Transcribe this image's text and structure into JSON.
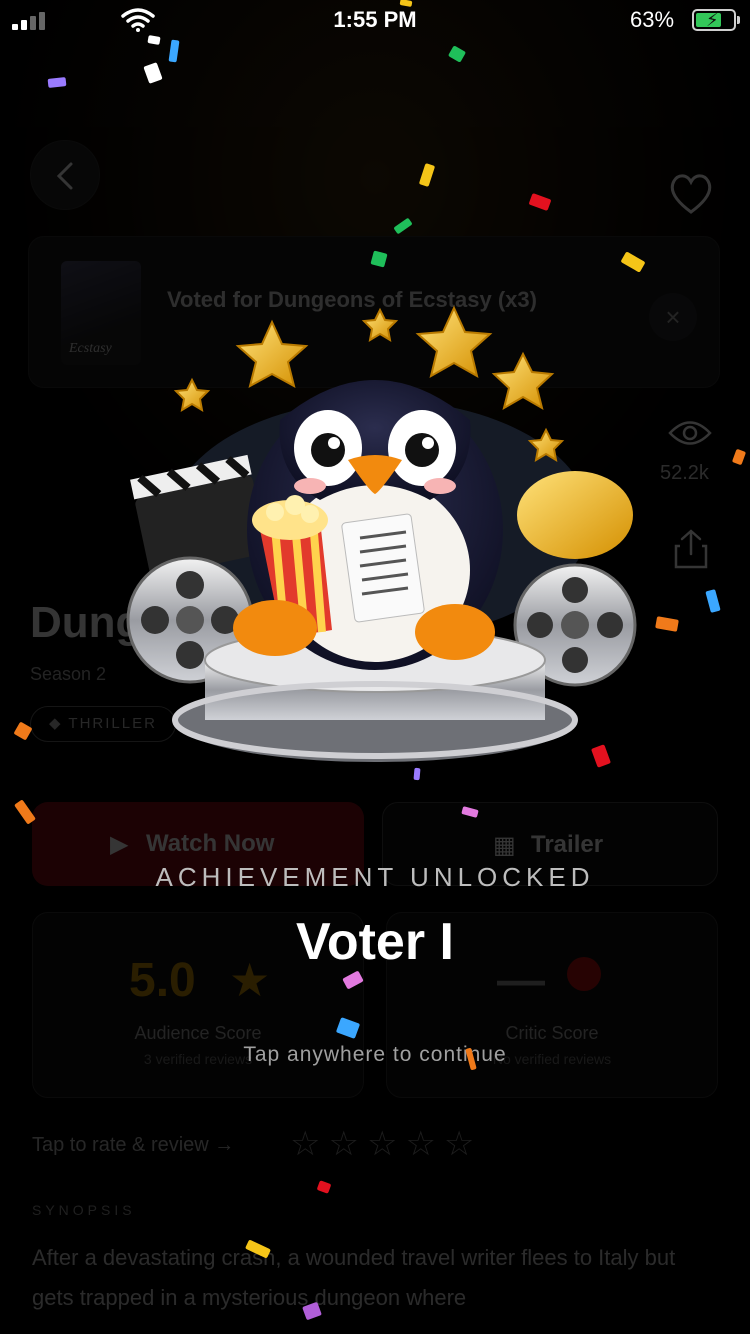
{
  "status_bar": {
    "time": "1:55 PM",
    "battery_percent": "63%",
    "battery_level": 0.63,
    "battery_color": "#33c759"
  },
  "toast": {
    "text": "Voted for Dungeons of Ecstasy (x3)",
    "close_icon": "close-icon"
  },
  "poster": {
    "thumb_text": "Ecstasy"
  },
  "stats": {
    "views": "52.2k"
  },
  "show": {
    "title": "Dungeons of Ecstasy",
    "season": "Season 2",
    "genre": "◆ THRILLER"
  },
  "actions": {
    "watch_label": "Watch Now",
    "trailer_label": "Trailer"
  },
  "scores": {
    "audience": {
      "value": "5.0",
      "label": "Audience Score",
      "sub": "3 verified reviews"
    },
    "critic": {
      "value": "—",
      "label": "Critic Score",
      "sub": "No verified reviews"
    }
  },
  "rating": {
    "prompt": "Tap to rate & review →",
    "stars": "☆☆☆☆☆"
  },
  "synopsis": {
    "heading": "SYNOPSIS",
    "text": "After a devastating crash, a wounded travel writer flees to Italy but gets trapped in a mysterious dungeon where"
  },
  "achievement": {
    "kicker": "ACHIEVEMENT UNLOCKED",
    "title": "Voter I",
    "hint": "Tap anywhere to continue",
    "badge_icon": "penguin-popcorn-badge-icon"
  },
  "colors": {
    "accent_gold": "#f5c518",
    "watch_button": "#8a0f18",
    "background": "#000000"
  }
}
